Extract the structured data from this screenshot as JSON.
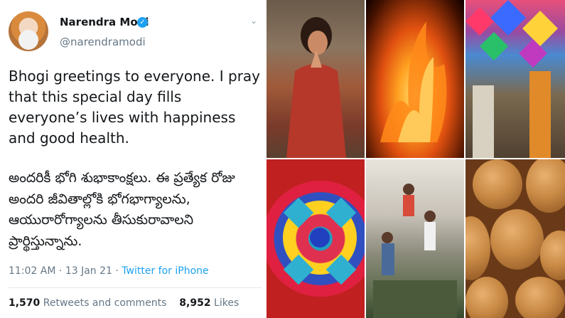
{
  "tweet": {
    "author_name": "Narendra Modi",
    "author_handle": "@narendramodi",
    "verified_mark": "✓",
    "menu_glyph": "⌄",
    "text_english": "Bhogi greetings to everyone. I pray that this special day fills everyone’s lives with happiness and good health.",
    "text_telugu": "అందరికీ భోగి శుభాకాంక్షలు. ఈ ప్రత్యేక రోజు అందరి జీవితాల్లోకి భోగభాగ్యాలను, ఆయురారోగ్యాలను తీసుకురావాలని ప్రార్థిస్తున్నాను.",
    "time": "11:02 AM",
    "date": "13 Jan 21",
    "separator": "·",
    "source": "Twitter for iPhone",
    "retweets_count": "1,570",
    "retweets_label": "Retweets and comments",
    "likes_count": "8,952",
    "likes_label": "Likes"
  },
  "collage": {
    "photos": [
      "woman-praying-river",
      "bonfire",
      "kite-stall",
      "rangoli",
      "human-pyramid",
      "sesame-ladoos"
    ]
  },
  "colors": {
    "twitter_blue": "#1da1f2",
    "text": "#14171a",
    "secondary": "#657786"
  }
}
